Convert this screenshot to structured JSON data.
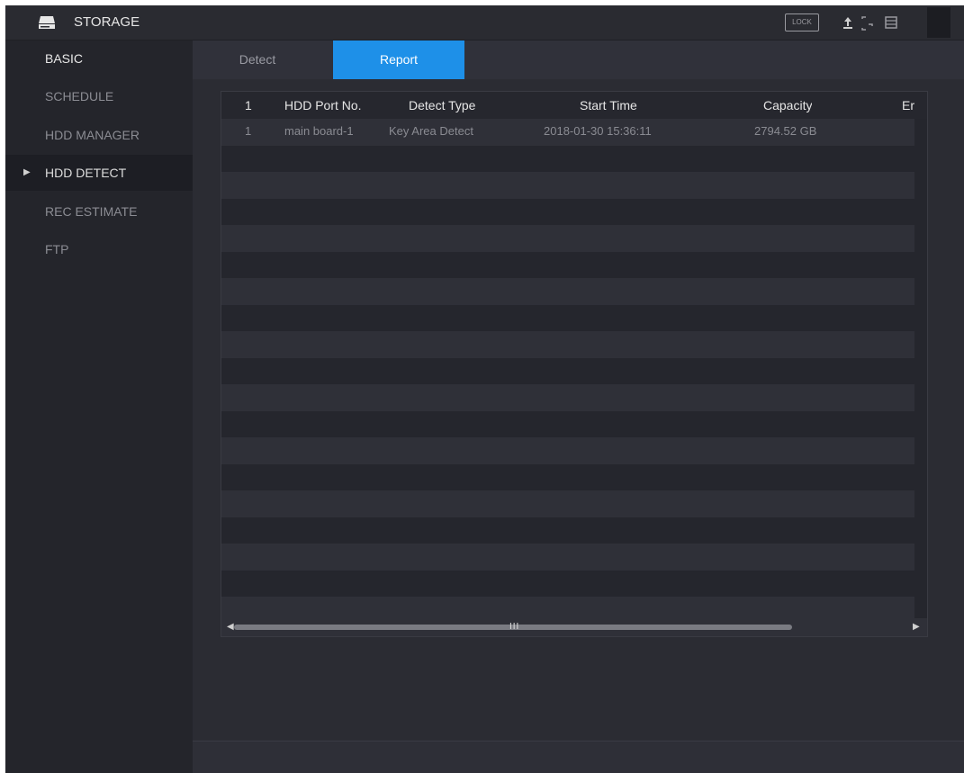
{
  "window": {
    "title": "STORAGE",
    "lock_badge": "LOCK",
    "icons": [
      "storage-icon",
      "upload-icon",
      "fullscreen-icon",
      "collapse-icon"
    ]
  },
  "sidebar": {
    "items": [
      {
        "label": "BASIC",
        "state": "header"
      },
      {
        "label": "SCHEDULE",
        "state": "normal"
      },
      {
        "label": "HDD MANAGER",
        "state": "normal"
      },
      {
        "label": "HDD DETECT",
        "state": "active"
      },
      {
        "label": "REC ESTIMATE",
        "state": "normal"
      },
      {
        "label": "FTP",
        "state": "normal"
      }
    ]
  },
  "tabs": {
    "detect": "Detect",
    "report": "Report",
    "selected": "Report"
  },
  "table": {
    "columns": [
      "1",
      "HDD Port No.",
      "Detect Type",
      "Start Time",
      "Capacity",
      "Er"
    ],
    "rows": [
      [
        "1",
        "main board-1",
        "Key Area Detect",
        "2018-01-30 15:36:11",
        "2794.52 GB",
        ""
      ]
    ],
    "scrollbar_grip": "III"
  },
  "colors": {
    "accent": "#1e90e8",
    "background": "#2b2c33",
    "sidebar": "#24252b"
  }
}
